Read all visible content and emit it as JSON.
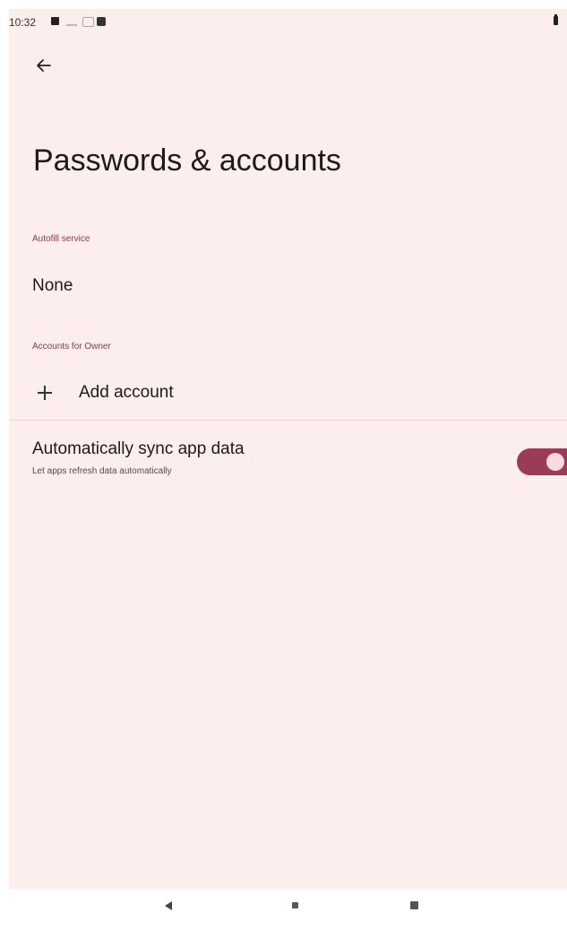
{
  "status_bar": {
    "time": "10:32",
    "icons": [
      "notification-icon",
      "wifi-icon",
      "sim-icon",
      "settings-icon",
      "battery-icon"
    ]
  },
  "header": {
    "back_icon": "arrow-left-icon",
    "title": "Passwords & accounts"
  },
  "autofill": {
    "section_label": "Autofill service",
    "value": "None"
  },
  "accounts": {
    "section_label": "Accounts for Owner",
    "add_label": "Add account",
    "add_icon": "plus-icon"
  },
  "sync": {
    "title": "Automatically sync app data",
    "summary": "Let apps refresh data automatically",
    "enabled": true
  },
  "nav_bar": {
    "icons": [
      "back-triangle-icon",
      "home-icon",
      "recents-icon"
    ]
  },
  "colors": {
    "background": "#fbeeec",
    "accent": "#8b3a4f",
    "toggle_track": "#9a3c58",
    "toggle_thumb": "#ffd9e2"
  }
}
